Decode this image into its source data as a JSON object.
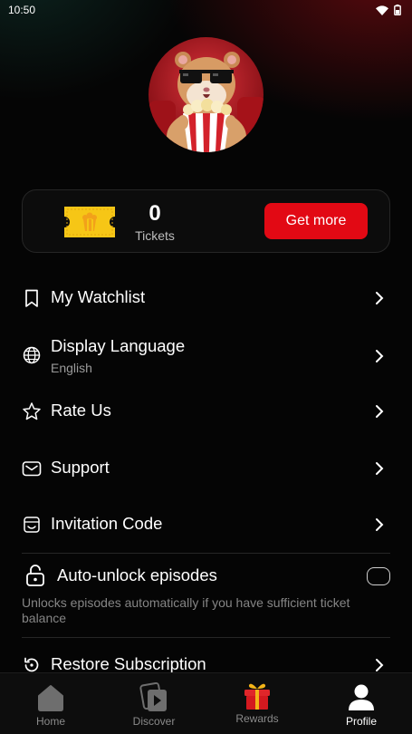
{
  "status_bar": {
    "time": "10:50"
  },
  "tickets": {
    "count": "0",
    "label": "Tickets",
    "get_more_label": "Get more"
  },
  "menu": {
    "watchlist": "My Watchlist",
    "language": "Display Language",
    "language_value": "English",
    "rate": "Rate Us",
    "support": "Support",
    "invitation": "Invitation Code",
    "restore": "Restore Subscription"
  },
  "auto_unlock": {
    "label": "Auto-unlock episodes",
    "description": "Unlocks episodes automatically if you have sufficient ticket balance",
    "enabled": false
  },
  "bottom_nav": {
    "home": "Home",
    "discover": "Discover",
    "rewards": "Rewards",
    "profile": "Profile"
  },
  "colors": {
    "accent": "#e20914",
    "background": "#050505"
  }
}
